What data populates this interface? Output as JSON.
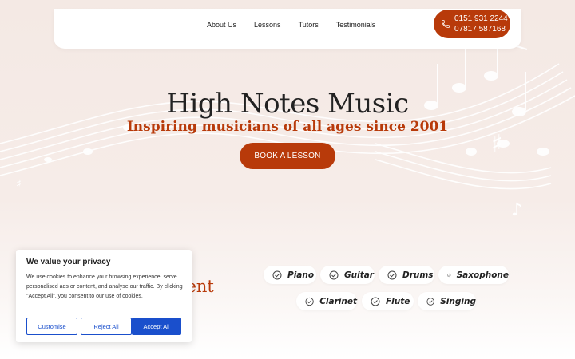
{
  "nav": {
    "links": [
      "About Us",
      "Lessons",
      "Tutors",
      "Testimonials"
    ],
    "phone_primary": "0151 931 2244",
    "phone_secondary": "07817 587168"
  },
  "hero": {
    "title": "High Notes Music",
    "subtitle": "Inspiring musicians of all ages since 2001",
    "cta_label": "BOOK A LESSON"
  },
  "instruments": {
    "heading_fragment": "ument",
    "items": [
      "Piano",
      "Guitar",
      "Drums",
      "Saxophone",
      "Clarinet",
      "Flute",
      "Singing"
    ]
  },
  "cookie": {
    "title": "We value your privacy",
    "body": "We use cookies to enhance your browsing experience, serve personalised ads or content, and analyse our traffic. By clicking \"Accept All\", you consent to our use of cookies.",
    "customise": "Customise",
    "reject": "Reject All",
    "accept": "Accept All"
  },
  "colors": {
    "accent": "#b83a0a",
    "cookie_blue": "#1a4fcc",
    "background": "#f4e9e4"
  },
  "icons": [
    "phone-icon",
    "check-circle-icon",
    "music-staff-decoration"
  ]
}
